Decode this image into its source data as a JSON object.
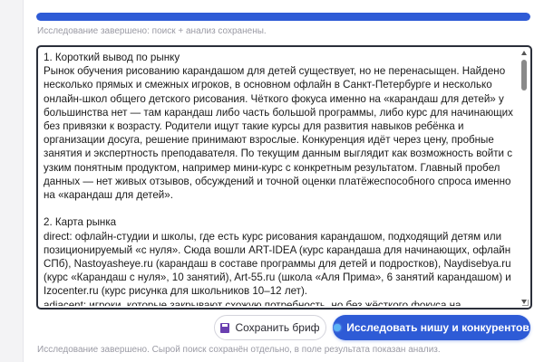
{
  "progress": {
    "fraction": 1.0,
    "color": "#2e5bd6"
  },
  "status_top": "Исследование завершено: поиск + анализ сохранены.",
  "result": {
    "text": "1. Короткий вывод по рынку\nРынок обучения рисованию карандашом для детей существует, но не перенасыщен. Найдено несколько прямых и смежных игроков, в основном офлайн в Санкт-Петербурге и несколько онлайн-школ общего детского рисования. Чёткого фокуса именно на «карандаш для детей» у большинства нет — там карандаш либо часть большой программы, либо курс для начинающих без привязки к возрасту. Родители ищут такие курсы для развития навыков ребёнка и организации досуга, решение принимают взрослые. Конкуренция идёт через цену, пробные занятия и экспертность преподавателя. По текущим данным выглядит как возможность войти с узким понятным продуктом, например мини-курс с конкретным результатом. Главный пробел данных — нет живых отзывов, обсуждений и точной оценки платёжеспособного спроса именно на «карандаш для детей».\n\n2. Карта рынка\ndirect: офлайн-студии и школы, где есть курс рисования карандашом, подходящий детям или позиционируемый «с нуля». Сюда вошли ART-IDEA (курс карандаша для начинающих, офлайн СПб), Nastoyasheye.ru (карандаш в составе программы для детей и подростков), Naydisebya.ru (курс «Карандаш с нуля», 10 занятий), Art-55.ru (школа «Аля Прима», 6 занятий карандашом) и Izocenter.ru (курс рисунка для школьников 10–12 лет).\nadjacent: игроки, которые закрывают схожую потребность, но без жёсткого фокуса на карандаше. Это онлайн-школы детского рисования Lil.school (методика, общее творчество), Hudozhnik.online (гуашь для детей 5–9 лет), центр творчества Kandarash.ru, а также Kalacheve School (годовая программа погружения в карандаш, но для всех возрастов)."
  },
  "buttons": {
    "save_label": "Сохранить бриф",
    "research_label": "Исследовать нишу и конкурентов"
  },
  "icons": {
    "save": "save-floppy-icon",
    "research": "lightbulb-icon"
  },
  "status_bottom": "Исследование завершено. Сырой поиск сохранён отдельно, в поле результата показан анализ."
}
